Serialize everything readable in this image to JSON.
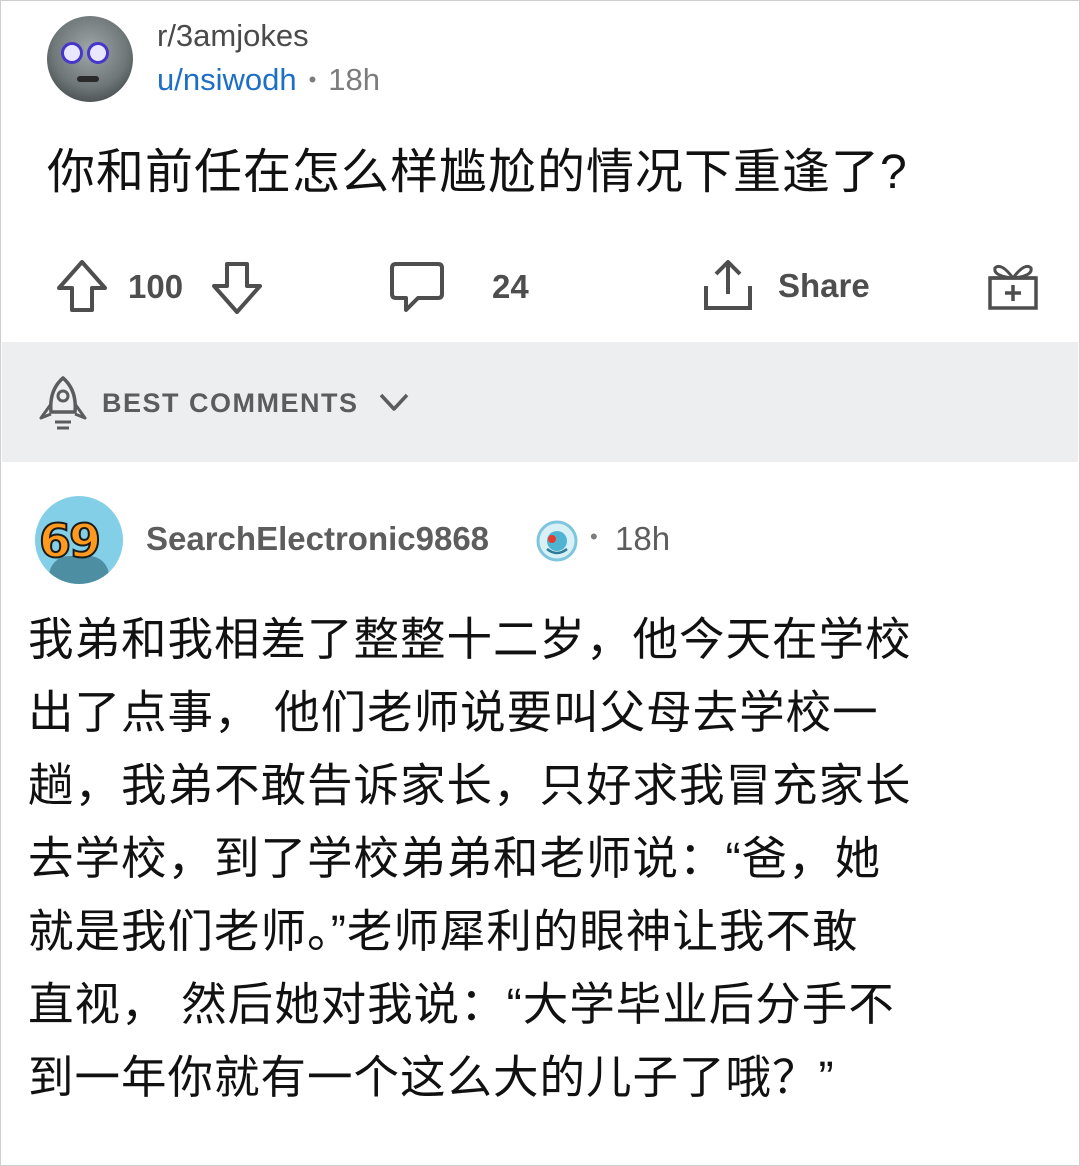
{
  "post": {
    "subreddit": "r/3amjokes",
    "author": "u/nsiwodh",
    "separator": "•",
    "time": "18h",
    "title": "你和前任在怎么样尴尬的情况下重逢了?",
    "score": "100",
    "comments_count": "24",
    "share_label": "Share"
  },
  "sort": {
    "label": "BEST COMMENTS"
  },
  "comment": {
    "avatar_text": "69",
    "username": "SearchElectronic9868",
    "separator": "•",
    "time": "18h",
    "lines": [
      "我弟和我相差了整整十二岁，他今天在学校",
      "出了点事， 他们老师说要叫父母去学校一",
      "趟，我弟不敢告诉家长，只好求我冒充家长",
      "去学校，到了学校弟弟和老师说：“爸，她",
      "就是我们老师。”老师犀利的眼神让我不敢",
      "直视， 然后她对我说：“大学毕业后分手不",
      "到一年你就有一个这么大的儿子了哦？”"
    ]
  }
}
